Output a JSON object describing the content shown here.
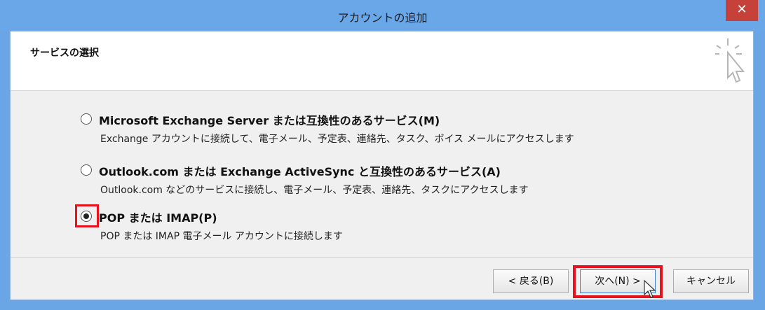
{
  "window": {
    "title": "アカウントの追加",
    "close_label": "✕"
  },
  "header": {
    "title": "サービスの選択",
    "icon": "wizard-cursor-icon"
  },
  "options": [
    {
      "label": "Microsoft Exchange Server または互換性のあるサービス(M)",
      "description": "Exchange アカウントに接続して、電子メール、予定表、連絡先、タスク、ボイス メールにアクセスします",
      "selected": false
    },
    {
      "label": "Outlook.com または Exchange ActiveSync と互換性のあるサービス(A)",
      "description": "Outlook.com などのサービスに接続し、電子メール、予定表、連絡先、タスクにアクセスします",
      "selected": false
    },
    {
      "label": "POP または IMAP(P)",
      "description": "POP または IMAP 電子メール アカウントに接続します",
      "selected": true
    }
  ],
  "buttons": {
    "back": "< 戻る(B)",
    "next": "次へ(N) >",
    "cancel": "キャンセル"
  },
  "colors": {
    "title_bar": "#69a7e8",
    "close": "#c7413b",
    "highlight": "#e8121f"
  }
}
